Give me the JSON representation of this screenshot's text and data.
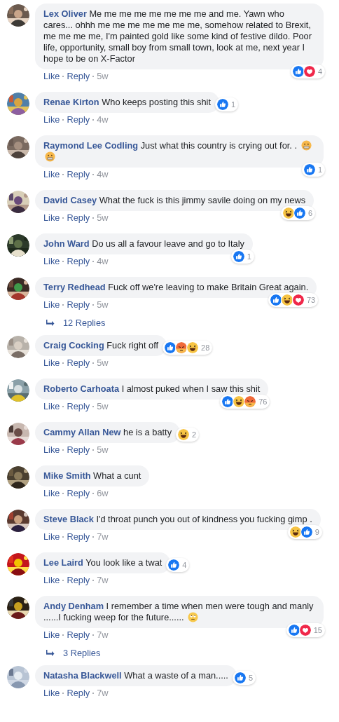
{
  "comments": [
    {
      "kind": "comment",
      "author": "Lex Oliver",
      "text": "Me me me me me me me me and me. Yawn who cares... ohhh me me me me me me me, somehow related to Brexit, me me me me, I'm painted gold like some kind of festive dildo. Poor life, opportunity, small boy from small town, look at me, next year I hope to be on X-Factor",
      "reactions": {
        "beside_text": false,
        "icons": [
          {
            "kind": "like"
          },
          {
            "kind": "love"
          }
        ],
        "count": "4"
      },
      "actions": [
        "Like",
        "Reply"
      ],
      "time": "5w"
    },
    {
      "kind": "comment",
      "author": "Renae Kirton",
      "text": "Who keeps posting this shit",
      "reactions": {
        "beside_text": true,
        "icons": [
          {
            "kind": "like"
          }
        ],
        "count": "1"
      },
      "actions": [
        "Like",
        "Reply"
      ],
      "time": "4w"
    },
    {
      "kind": "comment",
      "author": "Raymond Lee Codling",
      "text": "Just what this country is crying out for. .",
      "emoji": [
        {
          "kind": "grimace"
        },
        {
          "kind": "grimace"
        }
      ],
      "reactions": {
        "beside_text": false,
        "icons": [
          {
            "kind": "like"
          }
        ],
        "count": "1"
      },
      "actions": [
        "Like",
        "Reply"
      ],
      "time": "4w"
    },
    {
      "kind": "comment",
      "author": "David Casey",
      "text": "What the fuck is this jimmy savile doing on my news",
      "reactions": {
        "beside_text": false,
        "icons": [
          {
            "kind": "haha"
          },
          {
            "kind": "like"
          }
        ],
        "count": "6"
      },
      "actions": [
        "Like",
        "Reply"
      ],
      "time": "5w"
    },
    {
      "kind": "comment",
      "author": "John Ward",
      "text": "Do us all a favour leave and go to Italy",
      "reactions": {
        "beside_text": false,
        "icons": [
          {
            "kind": "like"
          }
        ],
        "count": "1"
      },
      "actions": [
        "Like",
        "Reply"
      ],
      "time": "4w"
    },
    {
      "kind": "comment",
      "author": "Terry Redhead",
      "text": "Fuck off we're leaving to make Britain Great again.",
      "reactions": {
        "beside_text": false,
        "icons": [
          {
            "kind": "like"
          },
          {
            "kind": "haha"
          },
          {
            "kind": "love"
          }
        ],
        "count": "73"
      },
      "actions": [
        "Like",
        "Reply"
      ],
      "time": "5w"
    },
    {
      "kind": "replies",
      "label": "12 Replies"
    },
    {
      "kind": "comment",
      "author": "Craig Cocking",
      "text": "Fuck right off",
      "reactions": {
        "beside_text": true,
        "icons": [
          {
            "kind": "like"
          },
          {
            "kind": "angry"
          },
          {
            "kind": "haha"
          }
        ],
        "count": "28"
      },
      "actions": [
        "Like",
        "Reply"
      ],
      "time": "5w"
    },
    {
      "kind": "comment",
      "author": "Roberto Carhoata",
      "text": "I almost puked when I saw this shit",
      "reactions": {
        "beside_text": false,
        "icons": [
          {
            "kind": "like"
          },
          {
            "kind": "haha"
          },
          {
            "kind": "angry"
          }
        ],
        "count": "76"
      },
      "actions": [
        "Like",
        "Reply"
      ],
      "time": "5w"
    },
    {
      "kind": "comment",
      "author": "Cammy Allan New",
      "text": "he is a batty",
      "reactions": {
        "beside_text": true,
        "icons": [
          {
            "kind": "haha"
          }
        ],
        "count": "2"
      },
      "actions": [
        "Like",
        "Reply"
      ],
      "time": "5w"
    },
    {
      "kind": "comment",
      "author": "Mike Smith",
      "text": "What a cunt",
      "actions": [
        "Like",
        "Reply"
      ],
      "time": "6w"
    },
    {
      "kind": "comment",
      "author": "Steve Black",
      "text": "I'd throat punch you out of kindness you fucking gimp .",
      "reactions": {
        "beside_text": false,
        "icons": [
          {
            "kind": "haha"
          },
          {
            "kind": "like"
          }
        ],
        "count": "9"
      },
      "actions": [
        "Like",
        "Reply"
      ],
      "time": "7w"
    },
    {
      "kind": "comment",
      "author": "Lee Laird",
      "text": "You look like a twat",
      "reactions": {
        "beside_text": true,
        "icons": [
          {
            "kind": "like"
          }
        ],
        "count": "4"
      },
      "actions": [
        "Like",
        "Reply"
      ],
      "time": "7w"
    },
    {
      "kind": "comment",
      "author": "Andy Denham",
      "text": "I remember a time when men were tough and manly ......I fucking weep for the future......",
      "emoji": [
        {
          "kind": "eyeroll"
        }
      ],
      "reactions": {
        "beside_text": false,
        "icons": [
          {
            "kind": "like"
          },
          {
            "kind": "love"
          }
        ],
        "count": "15"
      },
      "actions": [
        "Like",
        "Reply"
      ],
      "time": "7w"
    },
    {
      "kind": "replies",
      "label": "3 Replies"
    },
    {
      "kind": "comment",
      "author": "Natasha Blackwell",
      "text": "What a waste of a man.....",
      "reactions": {
        "beside_text": true,
        "icons": [
          {
            "kind": "like"
          }
        ],
        "count": "5"
      },
      "actions": [
        "Like",
        "Reply"
      ],
      "time": "7w"
    }
  ]
}
